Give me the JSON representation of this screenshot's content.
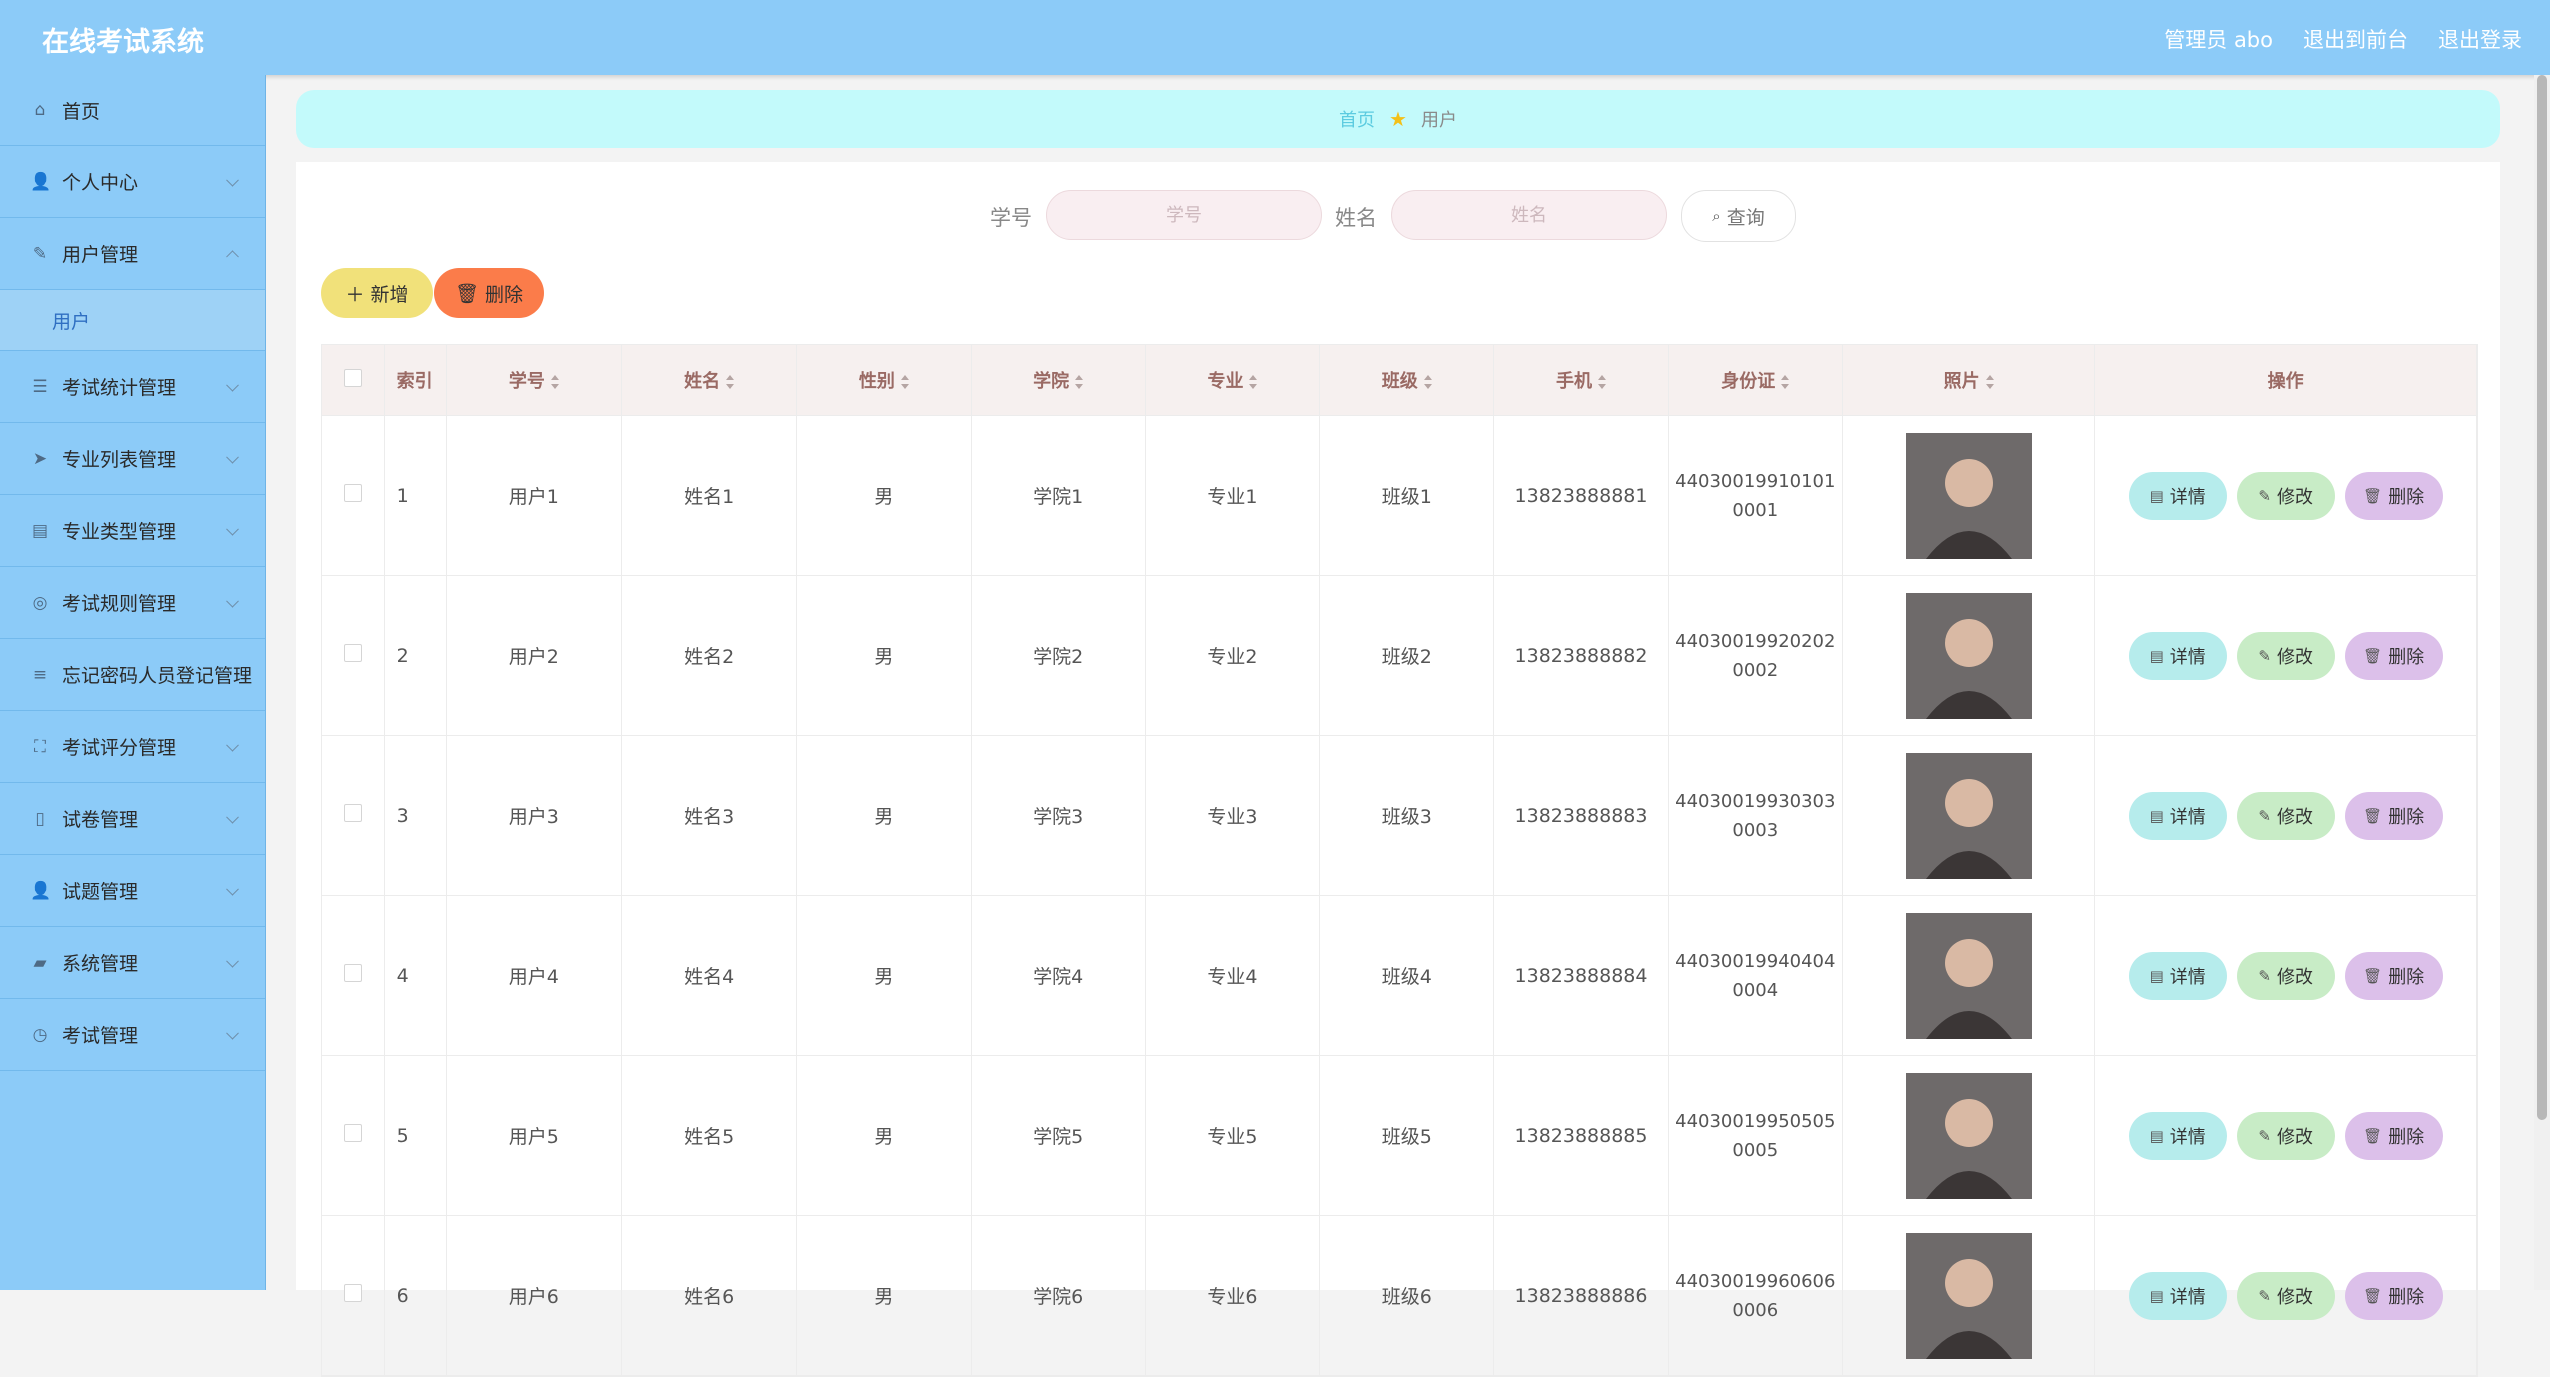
{
  "app": {
    "title": "在线考试系统"
  },
  "top_links": {
    "admin": "管理员 abo",
    "front": "退出到前台",
    "logout": "退出登录"
  },
  "sidebar": {
    "home": "首页",
    "items": [
      {
        "label": "个人中心",
        "icon": "👤"
      },
      {
        "label": "用户管理",
        "icon": "✎"
      },
      {
        "label": "考试统计管理",
        "icon": "☰"
      },
      {
        "label": "专业列表管理",
        "icon": "➤"
      },
      {
        "label": "专业类型管理",
        "icon": "▤"
      },
      {
        "label": "考试规则管理",
        "icon": "◎"
      },
      {
        "label": "忘记密码人员登记管理",
        "icon": "≡"
      },
      {
        "label": "考试评分管理",
        "icon": "⛶"
      },
      {
        "label": "试卷管理",
        "icon": "▯"
      },
      {
        "label": "试题管理",
        "icon": "👤"
      },
      {
        "label": "系统管理",
        "icon": "▰"
      },
      {
        "label": "考试管理",
        "icon": "◷"
      }
    ],
    "sub_user": "用户"
  },
  "breadcrumb": {
    "home": "首页",
    "current": "用户"
  },
  "search": {
    "xuehao_label": "学号",
    "xuehao_placeholder": "学号",
    "name_label": "姓名",
    "name_placeholder": "姓名",
    "query_label": "查询"
  },
  "actions": {
    "add_label": "新增",
    "delete_label": "删除"
  },
  "table": {
    "headers": {
      "index": "索引",
      "xuehao": "学号",
      "name": "姓名",
      "gender": "性别",
      "college": "学院",
      "major": "专业",
      "class": "班级",
      "phone": "手机",
      "idcard": "身份证",
      "photo": "照片",
      "ops": "操作"
    },
    "op_labels": {
      "detail": "详情",
      "edit": "修改",
      "delete": "删除"
    },
    "rows": [
      {
        "index": "1",
        "xuehao": "用户1",
        "name": "姓名1",
        "gender": "男",
        "college": "学院1",
        "major": "专业1",
        "class": "班级1",
        "phone": "13823888881",
        "id1": "44030019910101",
        "id2": "0001"
      },
      {
        "index": "2",
        "xuehao": "用户2",
        "name": "姓名2",
        "gender": "男",
        "college": "学院2",
        "major": "专业2",
        "class": "班级2",
        "phone": "13823888882",
        "id1": "44030019920202",
        "id2": "0002"
      },
      {
        "index": "3",
        "xuehao": "用户3",
        "name": "姓名3",
        "gender": "男",
        "college": "学院3",
        "major": "专业3",
        "class": "班级3",
        "phone": "13823888883",
        "id1": "44030019930303",
        "id2": "0003"
      },
      {
        "index": "4",
        "xuehao": "用户4",
        "name": "姓名4",
        "gender": "男",
        "college": "学院4",
        "major": "专业4",
        "class": "班级4",
        "phone": "13823888884",
        "id1": "44030019940404",
        "id2": "0004"
      },
      {
        "index": "5",
        "xuehao": "用户5",
        "name": "姓名5",
        "gender": "男",
        "college": "学院5",
        "major": "专业5",
        "class": "班级5",
        "phone": "13823888885",
        "id1": "44030019950505",
        "id2": "0005"
      },
      {
        "index": "6",
        "xuehao": "用户6",
        "name": "姓名6",
        "gender": "男",
        "college": "学院6",
        "major": "专业6",
        "class": "班级6",
        "phone": "13823888886",
        "id1": "44030019960606",
        "id2": "0006"
      }
    ]
  },
  "colors": {
    "topbar": "#8ccbf8",
    "breadcrumb_bg": "#c3fafb",
    "add_btn": "#f1e17a",
    "del_btn": "#fb7c4a"
  }
}
